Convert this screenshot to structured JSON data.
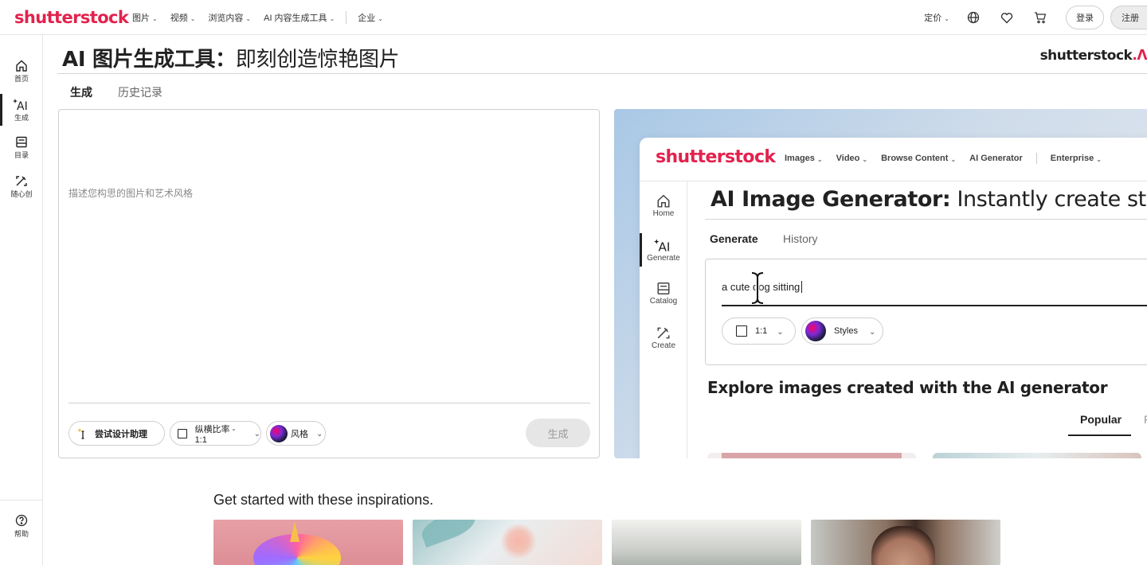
{
  "brand": {
    "logo": "shutterstock",
    "right_logo": "shutterstock",
    "right_logo_mark": ".ᐱ",
    "accent": "#e2224d"
  },
  "topnav": {
    "items": [
      {
        "label": "图片"
      },
      {
        "label": "视频"
      },
      {
        "label": "浏览内容"
      },
      {
        "label": "AI 内容生成工具"
      },
      {
        "label": "企业"
      }
    ],
    "pricing": "定价",
    "login": "登录",
    "signup": "注册"
  },
  "rail": {
    "items": [
      {
        "label": "首页",
        "icon": "home-icon"
      },
      {
        "label": "生成",
        "icon": "ai-sparkle-icon",
        "active": true
      },
      {
        "label": "目录",
        "icon": "catalog-icon"
      },
      {
        "label": "随心创",
        "icon": "create-icon"
      }
    ],
    "help": "帮助"
  },
  "page": {
    "title_bold": "AI 图片生成工具：",
    "title_rest": "即刻创造惊艳图片",
    "tabs": [
      "生成",
      "历史记录"
    ]
  },
  "prompt": {
    "placeholder": "描述您构思的图片和艺术风格",
    "assist": "尝试设计助理",
    "ratio": "纵横比率 - 1:1",
    "style": "风格",
    "generate": "生成"
  },
  "preview": {
    "logo": "shutterstock",
    "nav": [
      "Images",
      "Video",
      "Browse Content",
      "AI Generator",
      "Enterprise"
    ],
    "rail": [
      "Home",
      "Generate",
      "Catalog",
      "Create"
    ],
    "title_bold": "AI Image Generator:",
    "title_rest": " Instantly create stunning",
    "tabs": [
      "Generate",
      "History"
    ],
    "input_value": "a cute dog sitting",
    "ratio": "1:1",
    "styles": "Styles",
    "explore": "Explore images created with the AI generator",
    "popular": "Popular",
    "popular_next": "F"
  },
  "inspirations": {
    "heading": "Get started with these inspirations."
  }
}
